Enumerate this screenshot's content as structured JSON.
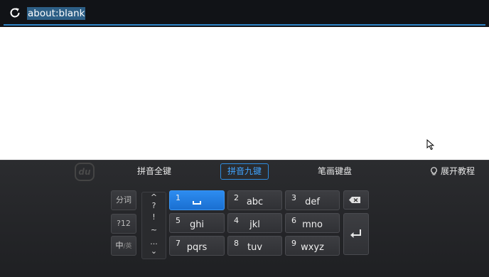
{
  "address_bar": {
    "url": "about:blank",
    "reload_icon": "reload-icon",
    "accent_color": "#2f84c6"
  },
  "cursor_icon": "mouse-pointer-icon",
  "keyboard": {
    "logo_text": "du",
    "modes": {
      "full": "拼音全键",
      "nine": "拼音九键",
      "stroke": "笔画键盘"
    },
    "selected_mode_color": "#3fa3ff",
    "tutorial": "展开教程",
    "tutorial_icon": "lightbulb-icon",
    "side_keys": {
      "segment": "分词",
      "symbols": "?12",
      "lang_main": "中",
      "lang_sub": "/英"
    },
    "punctuation": [
      "^",
      "?",
      "!",
      "~",
      "...",
      "⌄"
    ],
    "keys": [
      {
        "num": "1",
        "letters": ""
      },
      {
        "num": "2",
        "letters": "abc"
      },
      {
        "num": "3",
        "letters": "def"
      },
      {
        "num": "5",
        "letters": "ghi"
      },
      {
        "num": "4",
        "letters": "jkl"
      },
      {
        "num": "6",
        "letters": "mno"
      },
      {
        "num": "7",
        "letters": "pqrs"
      },
      {
        "num": "8",
        "letters": "tuv"
      },
      {
        "num": "9",
        "letters": "wxyz"
      }
    ],
    "backspace_icon": "backspace-icon",
    "enter_icon": "enter-icon"
  }
}
